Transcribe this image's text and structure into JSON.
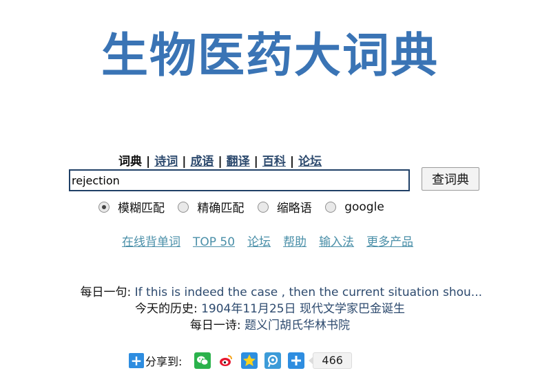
{
  "logo": {
    "text": "生物医药大词典"
  },
  "nav": {
    "tabs": [
      {
        "label": "词典",
        "active": true
      },
      {
        "label": "诗词",
        "active": false
      },
      {
        "label": "成语",
        "active": false
      },
      {
        "label": "翻译",
        "active": false
      },
      {
        "label": "百科",
        "active": false
      },
      {
        "label": "论坛",
        "active": false
      }
    ],
    "separator": "|"
  },
  "search": {
    "value": "rejection",
    "button_label": "查词典"
  },
  "match_options": [
    {
      "label": "模糊匹配",
      "checked": true
    },
    {
      "label": "精确匹配",
      "checked": false
    },
    {
      "label": "缩略语",
      "checked": false
    },
    {
      "label": "google",
      "checked": false
    }
  ],
  "links": [
    "在线背单词",
    "TOP 50",
    "论坛",
    "帮助",
    "输入法",
    "更多产品"
  ],
  "daily": {
    "sentence_label": "每日一句:",
    "sentence_value": "If this is indeed the case , then the current situation shou...",
    "history_label": "今天的历史:",
    "history_value": "1904年11月25日 现代文学家巴金诞生",
    "poem_label": "每日一诗:",
    "poem_value": "题义门胡氏华林书院"
  },
  "share": {
    "label": "分享到:",
    "count": "466",
    "icons": [
      "wechat-icon",
      "weibo-icon",
      "qzone-icon",
      "tencent-weibo-icon",
      "more-share-icon"
    ]
  },
  "colors": {
    "logo": "#3a74b5",
    "link": "#4a8fa8",
    "nav_link": "#2d4a6e",
    "share_blue": "#2e8de0"
  }
}
